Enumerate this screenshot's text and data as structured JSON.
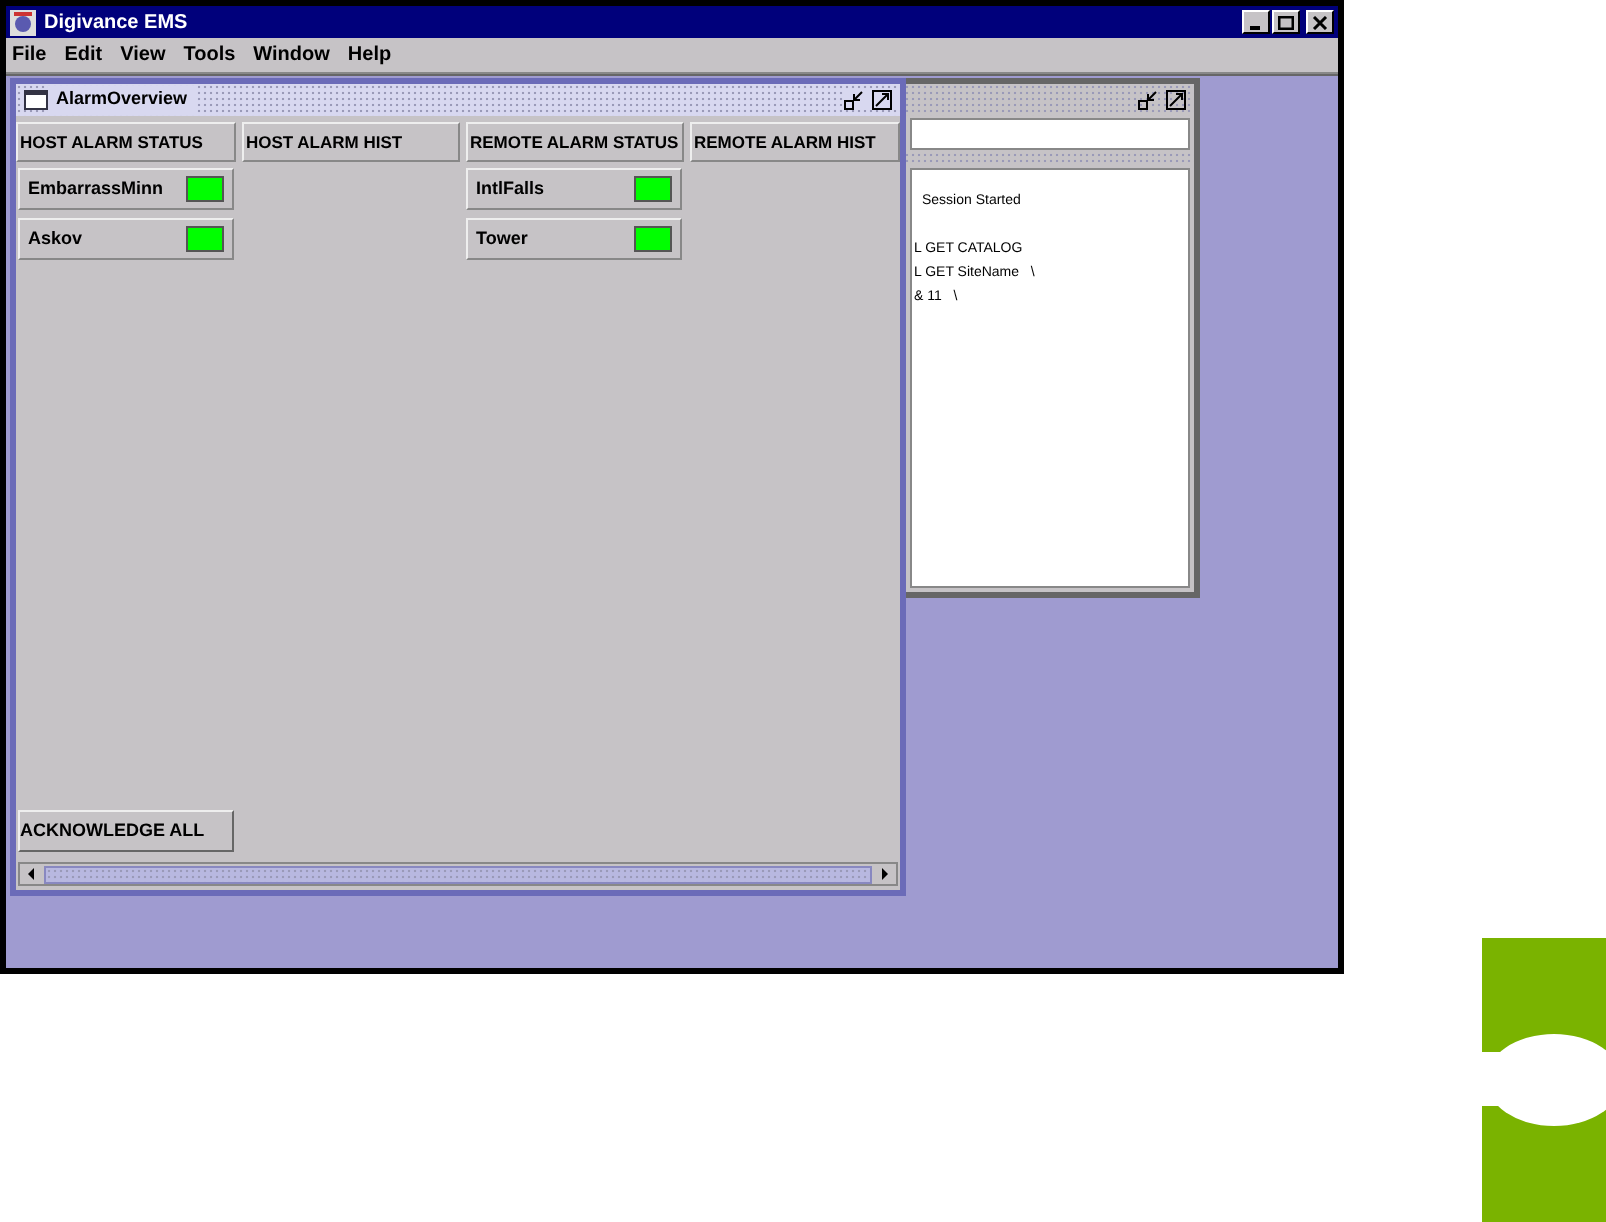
{
  "window": {
    "title": "Digivance EMS"
  },
  "menu": [
    "File",
    "Edit",
    "View",
    "Tools",
    "Window",
    "Help"
  ],
  "log_window": {
    "lines": [
      "Session Started",
      "L GET CATALOG",
      "L GET SiteName   \\",
      "& 11   \\"
    ]
  },
  "alarm_overview": {
    "title": "AlarmOverview",
    "columns": [
      "HOST ALARM STATUS",
      "HOST ALARM HIST",
      "REMOTE ALARM STATUS",
      "REMOTE ALARM HIST"
    ],
    "host_alarms": [
      {
        "name": "EmbarrassMinn",
        "color": "#00ff00"
      },
      {
        "name": "Askov",
        "color": "#00ff00"
      }
    ],
    "remote_alarms": [
      {
        "name": "IntlFalls",
        "color": "#00ff00"
      },
      {
        "name": "Tower",
        "color": "#00ff00"
      }
    ],
    "button": "ACKNOWLEDGE ALL"
  }
}
